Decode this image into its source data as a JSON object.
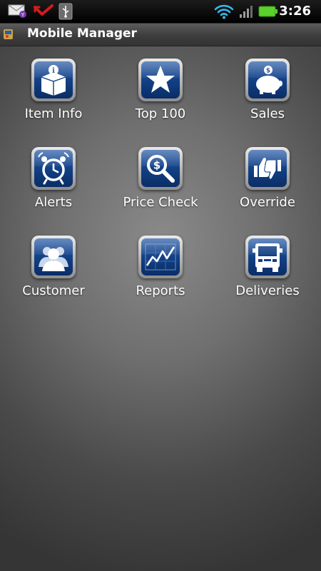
{
  "status_bar": {
    "time": "3:26"
  },
  "app": {
    "title": "Mobile Manager"
  },
  "menu": [
    {
      "label": "Item Info",
      "icon": "info-box-icon"
    },
    {
      "label": "Top 100",
      "icon": "star-icon"
    },
    {
      "label": "Sales",
      "icon": "piggy-bank-icon"
    },
    {
      "label": "Alerts",
      "icon": "alarm-clock-icon"
    },
    {
      "label": "Price Check",
      "icon": "magnifier-dollar-icon"
    },
    {
      "label": "Override",
      "icon": "thumbs-up-down-icon"
    },
    {
      "label": "Customer",
      "icon": "people-icon"
    },
    {
      "label": "Reports",
      "icon": "line-chart-icon"
    },
    {
      "label": "Deliveries",
      "icon": "truck-icon"
    }
  ],
  "colors": {
    "icon_blue": "#113f83",
    "battery_green": "#5ad12c",
    "wifi_blue": "#35b9ec",
    "status_bar": "#000000"
  }
}
